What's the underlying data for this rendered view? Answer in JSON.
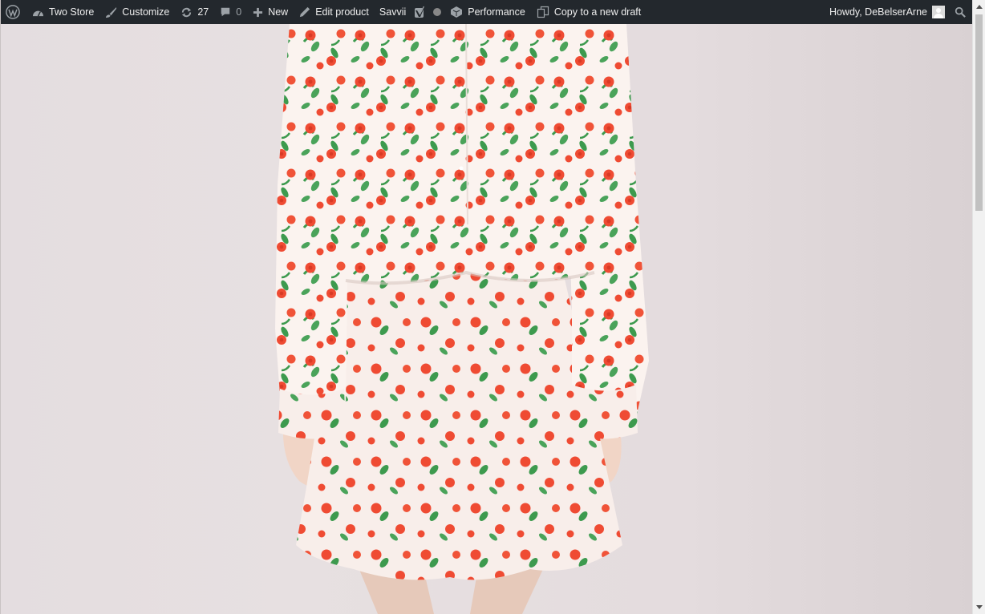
{
  "admin_bar": {
    "site_name": "Two Store",
    "customize": "Customize",
    "updates_count": "27",
    "comments_count": "0",
    "new": "New",
    "edit_product": "Edit product",
    "savvii": "Savvii",
    "performance": "Performance",
    "copy_draft": "Copy to a new draft",
    "howdy": "Howdy, DeBelserArne"
  },
  "colors": {
    "admin_bar_bg": "#23282d",
    "fabric_bg": "#fbf3ef",
    "flower_red": "#ef4b33",
    "leaf_green": "#3d9a4e",
    "backdrop": "#e4dde0"
  },
  "icons": [
    "wordpress-logo-icon",
    "dashboard-icon",
    "brush-icon",
    "updates-icon",
    "comment-icon",
    "plus-icon",
    "pencil-icon",
    "yoast-icon",
    "status-dot-icon",
    "performance-icon",
    "copy-icon",
    "avatar",
    "search-icon"
  ]
}
